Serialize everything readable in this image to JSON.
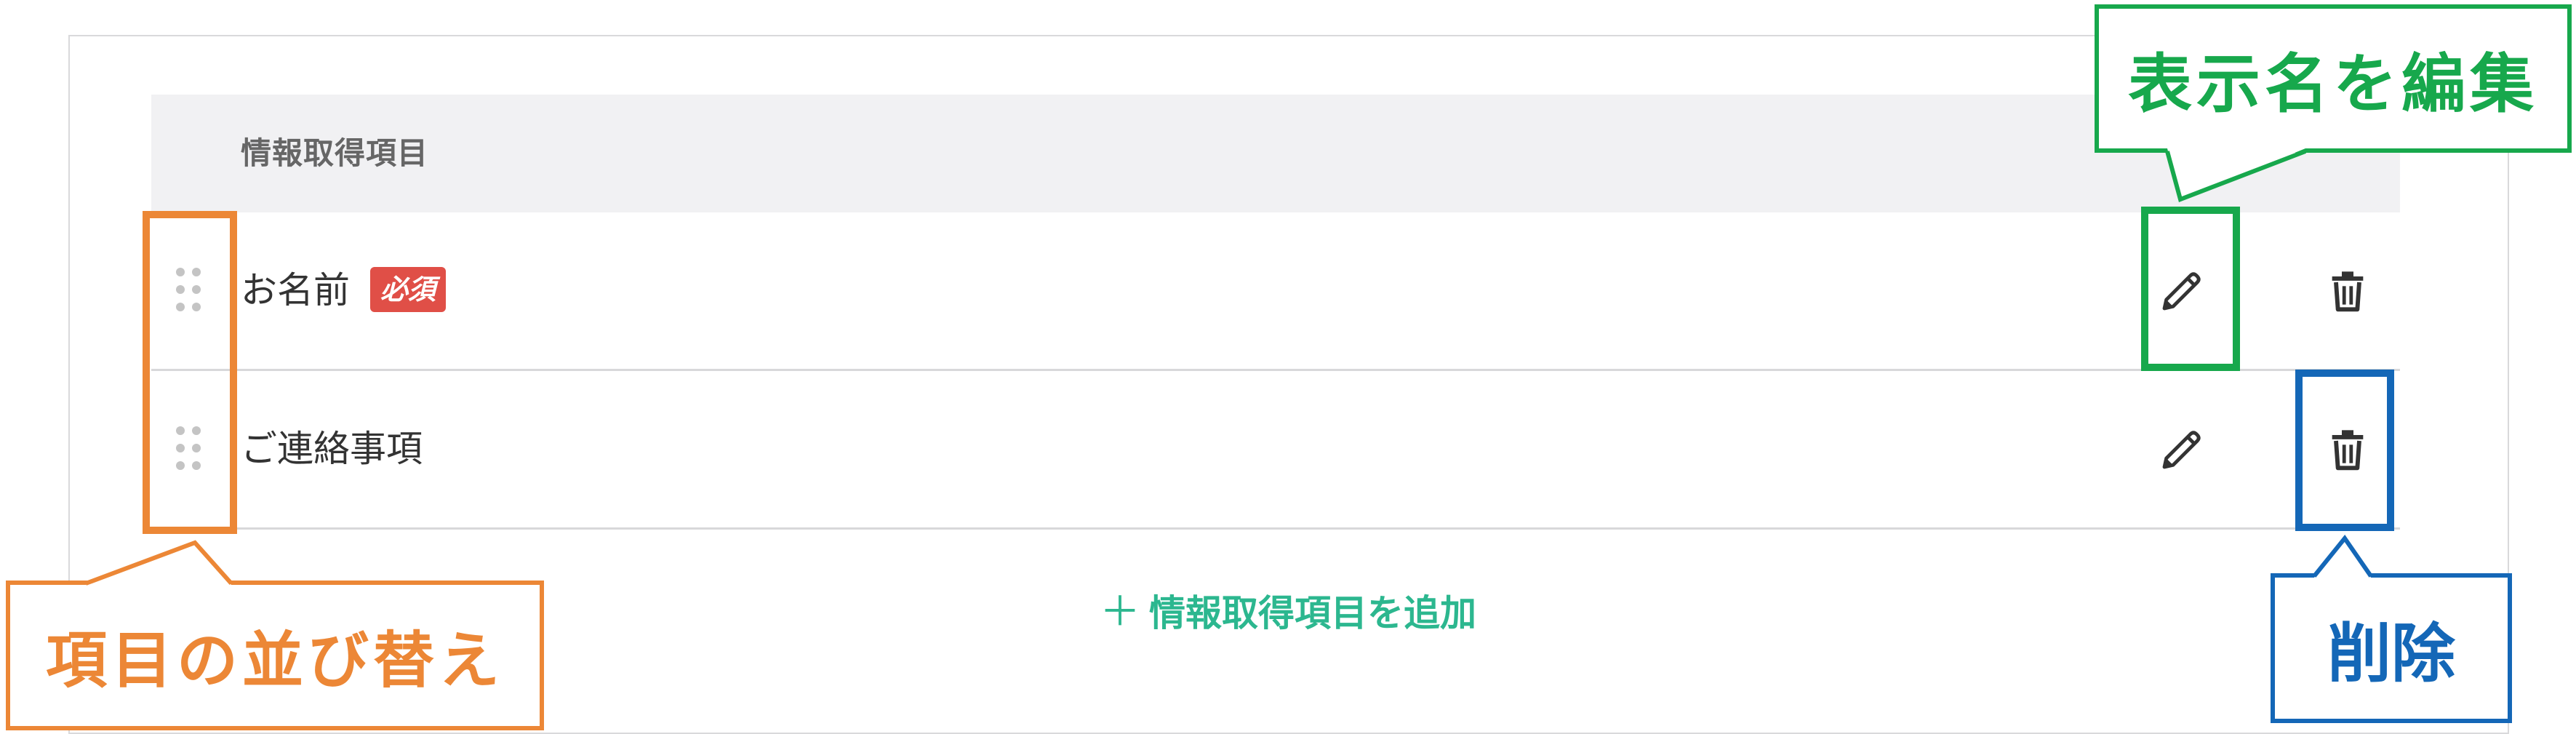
{
  "table": {
    "header_label": "情報取得項目",
    "rows": [
      {
        "label": "お名前",
        "badge": "必須"
      },
      {
        "label": "ご連絡事項"
      }
    ],
    "add_button_label": "情報取得項目を追加"
  },
  "annotations": {
    "reorder": "項目の並び替え",
    "edit": "表示名を編集",
    "delete": "削除"
  },
  "icons": [
    "drag-handle-icon",
    "pencil-icon",
    "trash-icon",
    "plus-icon"
  ],
  "colors": {
    "badge": "#e04f47",
    "add_link": "#2cb78f",
    "reorder_annotation": "#ec8736",
    "edit_annotation": "#17a84c",
    "delete_annotation": "#1467b7"
  }
}
